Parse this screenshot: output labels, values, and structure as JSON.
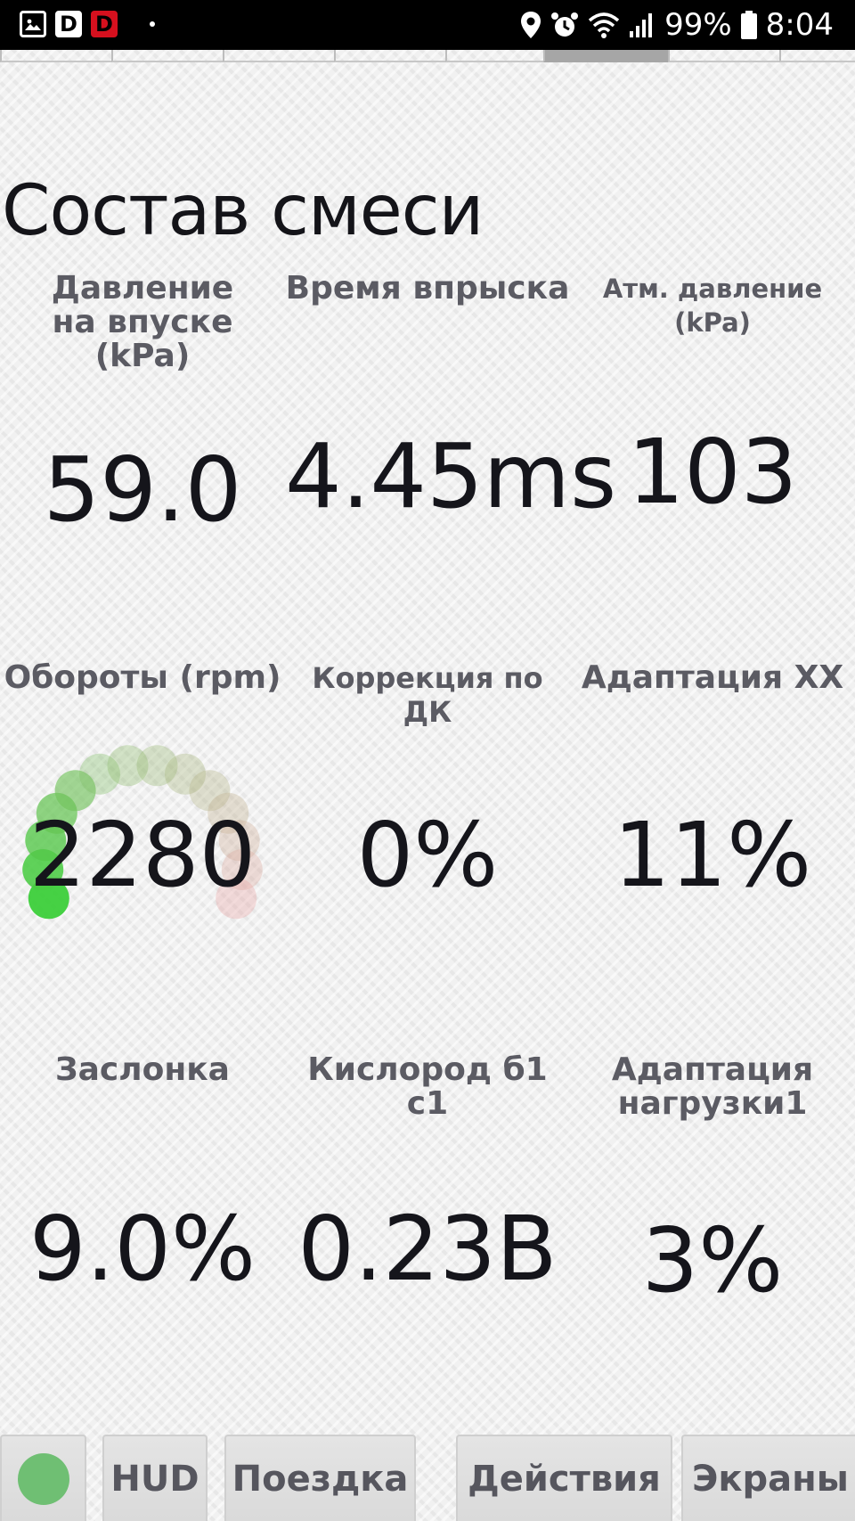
{
  "status_bar": {
    "battery": "99%",
    "time": "8:04",
    "left_icons": [
      "gallery-icon",
      "d-icon",
      "d-red-icon"
    ],
    "right_icons": [
      "location-icon",
      "alarm-icon",
      "wifi-icon",
      "signal-icon",
      "battery-icon"
    ],
    "d_letter": "D",
    "d_red_letter": "D"
  },
  "tabs": {
    "count": 8,
    "active_index": 5
  },
  "page": {
    "title": "Состав смеси"
  },
  "gauges": [
    {
      "label": "Давление\nна впуске (kPa)",
      "value": "59.0"
    },
    {
      "label": "Время впрыска",
      "value": "4.45ms"
    },
    {
      "label": "Атм. давление (kPa)",
      "value": "103"
    },
    {
      "label": "Обороты (rpm)",
      "value": "2280"
    },
    {
      "label": "Коррекция по ДК",
      "value": "0%"
    },
    {
      "label": "Адаптация ХХ",
      "value": "11%"
    },
    {
      "label": "Заслонка",
      "value": "9.0%"
    },
    {
      "label": "Кислород б1 с1",
      "value": "0.23В"
    },
    {
      "label": "Адаптация\nнагрузки1",
      "value": "3%"
    }
  ],
  "rpm_gauge": {
    "value": 2280,
    "colors": {
      "low": "#3ccf3a",
      "high": "#e8a4a4"
    }
  },
  "bottom_bar": {
    "status_color": "#6fbf73",
    "buttons": [
      "HUD",
      "Поездка",
      "Действия",
      "Экраны"
    ]
  }
}
